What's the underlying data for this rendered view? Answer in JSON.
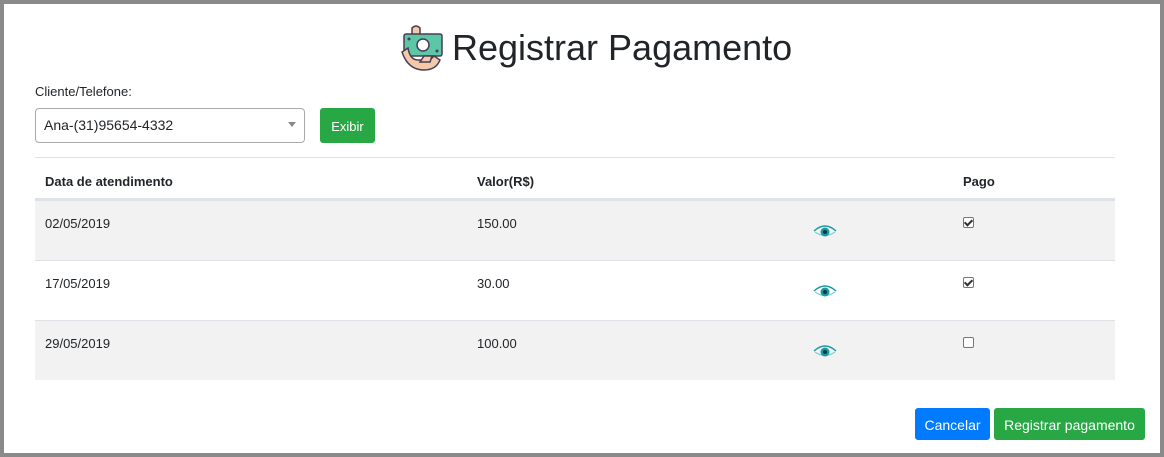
{
  "header": {
    "title": "Registrar Pagamento",
    "icon": "money-hand-icon"
  },
  "form": {
    "client_label": "Cliente/Telefone:",
    "client_selected": "Ana-(31)95654-4332",
    "show_button": "Exibir"
  },
  "table": {
    "columns": [
      "Data de atendimento",
      "Valor(R$)",
      "",
      "Pago"
    ],
    "rows": [
      {
        "date": "02/05/2019",
        "value": "150.00",
        "paid": true
      },
      {
        "date": "17/05/2019",
        "value": "30.00",
        "paid": true
      },
      {
        "date": "29/05/2019",
        "value": "100.00",
        "paid": false
      }
    ]
  },
  "footer": {
    "cancel": "Cancelar",
    "register": "Registrar pagamento"
  },
  "colors": {
    "green": "#28a745",
    "blue": "#007bff",
    "eye": "#1a9aa0"
  }
}
